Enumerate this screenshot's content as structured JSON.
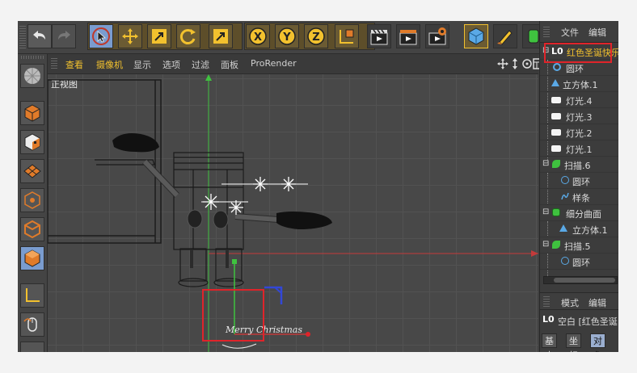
{
  "viewport_menu": {
    "items": [
      "查看",
      "摄像机",
      "显示",
      "选项",
      "过滤",
      "面板",
      "ProRender"
    ],
    "view_label": "正视图"
  },
  "object_manager": {
    "menu": [
      "文件",
      "编辑"
    ],
    "items": [
      {
        "label": "红色圣诞快乐",
        "icon": "null-object-icon",
        "highlighted": true
      },
      {
        "label": "圆环",
        "icon": "circle-spline-icon"
      },
      {
        "label": "立方体.1",
        "icon": "cube-icon"
      },
      {
        "label": "灯光.4",
        "icon": "light-icon"
      },
      {
        "label": "灯光.3",
        "icon": "light-icon"
      },
      {
        "label": "灯光.2",
        "icon": "light-icon"
      },
      {
        "label": "灯光.1",
        "icon": "light-icon"
      },
      {
        "label": "扫描.6",
        "icon": "sweep-icon"
      },
      {
        "label": "圆环",
        "icon": "circle-spline-icon"
      },
      {
        "label": "样条",
        "icon": "spline-icon"
      },
      {
        "label": "细分曲面",
        "icon": "subdivision-icon"
      },
      {
        "label": "立方体.1",
        "icon": "cube-icon"
      },
      {
        "label": "扫描.5",
        "icon": "sweep-icon"
      },
      {
        "label": "圆环",
        "icon": "circle-spline-icon"
      }
    ]
  },
  "attributes": {
    "menu": [
      "模式",
      "编辑"
    ],
    "title": "空白 [红色圣诞",
    "tabs": [
      "基本",
      "坐标",
      "对象"
    ],
    "active_tab": "对象"
  },
  "logo_text": "Merry Christmas",
  "colors": {
    "highlight_red": "#e0242a",
    "accent_yellow": "#f2c12e",
    "select_blue": "#7a9ccf",
    "axis_green": "#3fc23f",
    "axis_red": "#c33a3a",
    "axis_blue": "#3347d6"
  }
}
